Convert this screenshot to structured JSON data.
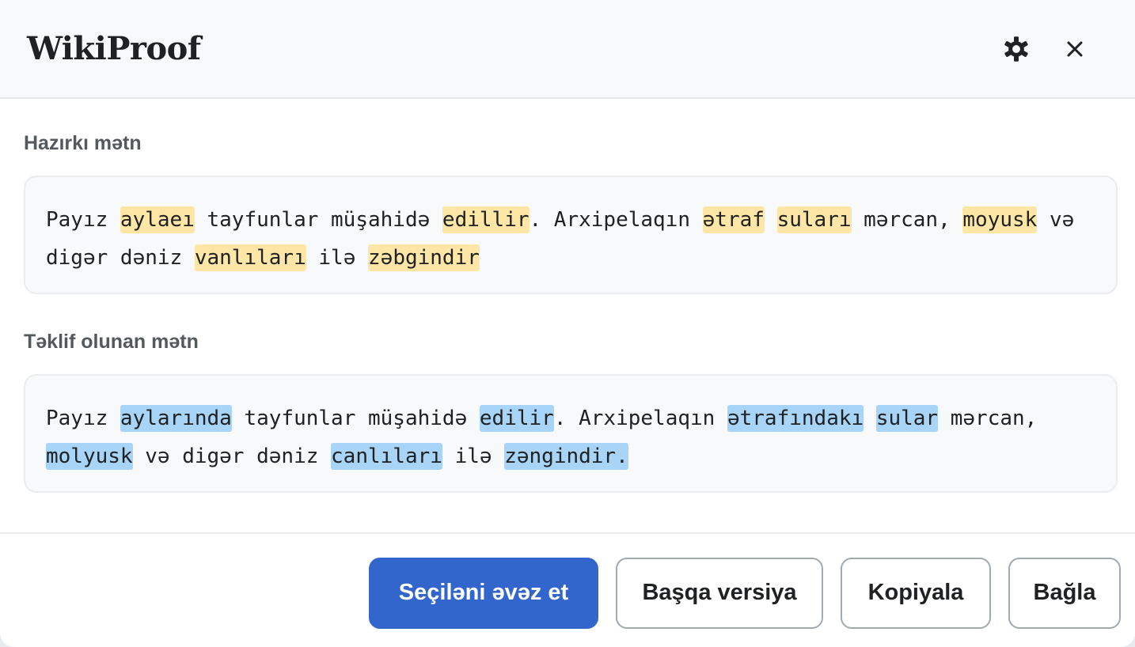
{
  "header": {
    "title": "WikiProof"
  },
  "original": {
    "label": "Hazırkı mətn",
    "segments": [
      {
        "text": "Payız ",
        "hl": false
      },
      {
        "text": "aylaeı",
        "hl": true
      },
      {
        "text": " tayfunlar müşahidə ",
        "hl": false
      },
      {
        "text": "edillir",
        "hl": true
      },
      {
        "text": ". Arxipelaqın ",
        "hl": false
      },
      {
        "text": "ətraf",
        "hl": true
      },
      {
        "text": " ",
        "hl": false
      },
      {
        "text": "suları",
        "hl": true
      },
      {
        "text": " mərcan, ",
        "hl": false
      },
      {
        "text": "moyusk",
        "hl": true
      },
      {
        "text": " və digər dəniz ",
        "hl": false
      },
      {
        "text": "vanlıları",
        "hl": true
      },
      {
        "text": " ilə ",
        "hl": false
      },
      {
        "text": "zəbgindir",
        "hl": true
      }
    ]
  },
  "suggested": {
    "label": "Təklif olunan mətn",
    "segments": [
      {
        "text": "Payız ",
        "hl": false
      },
      {
        "text": "aylarında",
        "hl": true
      },
      {
        "text": " tayfunlar müşahidə ",
        "hl": false
      },
      {
        "text": "edilir",
        "hl": true
      },
      {
        "text": ". Arxipelaqın ",
        "hl": false
      },
      {
        "text": "ətrafındakı",
        "hl": true
      },
      {
        "text": " ",
        "hl": false
      },
      {
        "text": "sular",
        "hl": true
      },
      {
        "text": " mərcan, ",
        "hl": false
      },
      {
        "text": "molyusk",
        "hl": true
      },
      {
        "text": " və digər dəniz ",
        "hl": false
      },
      {
        "text": "canlıları",
        "hl": true
      },
      {
        "text": " ilə ",
        "hl": false
      },
      {
        "text": "zəngindir.",
        "hl": true
      }
    ]
  },
  "footer": {
    "replace_label": "Seçiləni əvəz et",
    "other_version_label": "Başqa versiya",
    "copy_label": "Kopiyala",
    "close_label": "Bağla"
  },
  "icons": {
    "settings": "gear-icon",
    "close": "close-icon"
  },
  "colors": {
    "primary": "#3366cc",
    "original_highlight": "#fee7a6",
    "suggested_highlight": "#a7d4f7",
    "text": "#202122",
    "label": "#54595d"
  }
}
